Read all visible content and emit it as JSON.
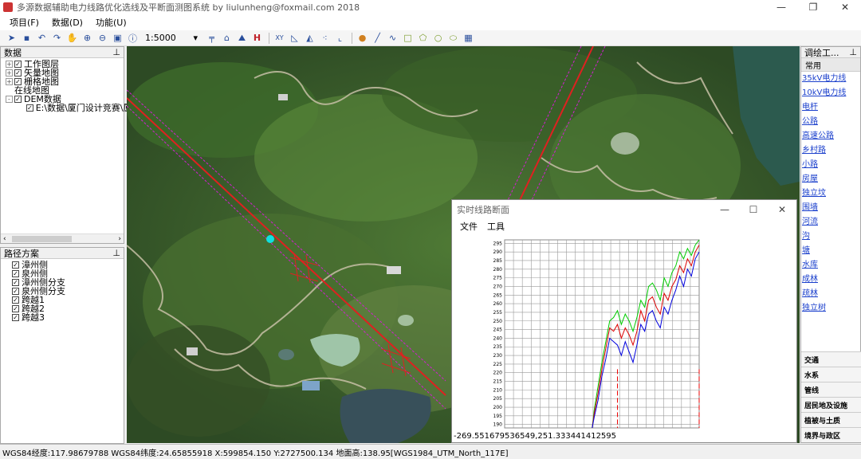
{
  "window": {
    "title": "多源数据辅助电力线路优化选线及平断面测图系统 by liulunheng@foxmail.com 2018",
    "controls": [
      "—",
      "❐",
      "✕"
    ]
  },
  "menu": [
    "项目(F)",
    "数据(D)",
    "功能(U)"
  ],
  "toolbar": {
    "scale": "1:5000",
    "xy_label": "XY",
    "h_label": "H"
  },
  "data_panel": {
    "title": "数据",
    "pin": "ᵖ",
    "items": [
      {
        "label": "工作图层",
        "expander": "+",
        "checked": true,
        "indent": 0
      },
      {
        "label": "矢量地图",
        "expander": "+",
        "checked": true,
        "indent": 0
      },
      {
        "label": "栅格地图",
        "expander": "+",
        "checked": true,
        "indent": 0
      },
      {
        "label": "在线地图",
        "expander": "",
        "checked": null,
        "indent": 0
      },
      {
        "label": "DEM数据",
        "expander": "-",
        "checked": true,
        "indent": 0
      },
      {
        "label": "E:\\数据\\厦门设计竞赛\\厦",
        "expander": "",
        "checked": true,
        "indent": 1
      }
    ]
  },
  "route_panel": {
    "title": "路径方案",
    "pin": "ᵖ",
    "items": [
      "漳州侧",
      "泉州侧",
      "漳州侧分支",
      "泉州侧分支",
      "跨越1",
      "跨越2",
      "跨越3"
    ]
  },
  "profile_window": {
    "title": "实时线路断面",
    "menu": [
      "文件",
      "工具"
    ],
    "coord": "-269.551679536549,251.333441412595",
    "controls": [
      "—",
      "☐",
      "✕"
    ]
  },
  "chart_data": {
    "type": "line",
    "yticks": [
      190,
      195,
      200,
      205,
      210,
      215,
      220,
      225,
      230,
      235,
      240,
      245,
      250,
      255,
      260,
      265,
      270,
      275,
      280,
      285,
      290,
      295
    ],
    "ylim": [
      188,
      297
    ],
    "series": [
      {
        "color": "#00cc00",
        "x": [
          0.45,
          0.46,
          0.48,
          0.5,
          0.52,
          0.54,
          0.56,
          0.58,
          0.6,
          0.62,
          0.64,
          0.66,
          0.68,
          0.7,
          0.72,
          0.74,
          0.76,
          0.78,
          0.8,
          0.82,
          0.84,
          0.86,
          0.88,
          0.9,
          0.92,
          0.94,
          0.96,
          0.98,
          1.0
        ],
        "y": [
          188,
          198,
          212,
          226,
          238,
          250,
          252,
          256,
          248,
          254,
          250,
          244,
          252,
          262,
          258,
          270,
          272,
          268,
          262,
          275,
          270,
          278,
          282,
          290,
          286,
          292,
          288,
          294,
          297
        ]
      },
      {
        "color": "#dd0000",
        "x": [
          0.45,
          0.46,
          0.48,
          0.5,
          0.52,
          0.54,
          0.56,
          0.58,
          0.6,
          0.62,
          0.64,
          0.66,
          0.68,
          0.7,
          0.72,
          0.74,
          0.76,
          0.78,
          0.8,
          0.82,
          0.84,
          0.86,
          0.88,
          0.9,
          0.92,
          0.94,
          0.96,
          0.98,
          1.0
        ],
        "y": [
          188,
          196,
          208,
          222,
          234,
          246,
          244,
          248,
          240,
          246,
          242,
          236,
          244,
          256,
          250,
          262,
          264,
          258,
          254,
          266,
          262,
          270,
          274,
          282,
          278,
          286,
          282,
          290,
          294
        ]
      },
      {
        "color": "#0000dd",
        "x": [
          0.45,
          0.46,
          0.48,
          0.5,
          0.52,
          0.54,
          0.56,
          0.58,
          0.6,
          0.62,
          0.64,
          0.66,
          0.68,
          0.7,
          0.72,
          0.74,
          0.76,
          0.78,
          0.8,
          0.82,
          0.84,
          0.86,
          0.88,
          0.9,
          0.92,
          0.94,
          0.96,
          0.98,
          1.0
        ],
        "y": [
          188,
          194,
          204,
          218,
          228,
          240,
          238,
          236,
          230,
          238,
          232,
          226,
          236,
          248,
          244,
          254,
          256,
          250,
          246,
          258,
          254,
          262,
          268,
          276,
          270,
          280,
          276,
          286,
          290
        ]
      }
    ],
    "grid": true
  },
  "right_panel": {
    "title": "调绘工...",
    "pin": "ᵖ",
    "tab": "常用",
    "links": [
      "35kV电力线",
      "10kV电力线",
      "电杆",
      "公路",
      "高速公路",
      "乡村路",
      "小路",
      "房屋",
      "独立坟",
      "围墙",
      "河流",
      "沟",
      "塘",
      "水库",
      "成林",
      "疏林",
      "独立树"
    ],
    "categories": [
      "交通",
      "水系",
      "管线",
      "居民地及设施",
      "植被与土质",
      "境界与政区"
    ]
  },
  "status": "WGS84经度:117.98679788  WGS84纬度:24.65855918  X:599854.150  Y:2727500.134  地面高:138.95[WGS1984_UTM_North_117E]"
}
